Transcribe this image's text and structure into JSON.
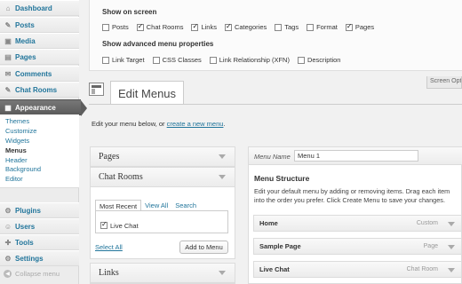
{
  "sidebar": {
    "items": [
      {
        "label": "Dashboard",
        "icon": "dashboard-icon",
        "glyph": "⌂"
      },
      {
        "label": "Posts",
        "icon": "pin-icon",
        "glyph": "✎"
      },
      {
        "label": "Media",
        "icon": "media-icon",
        "glyph": "▣"
      },
      {
        "label": "Pages",
        "icon": "pages-icon",
        "glyph": "▤"
      },
      {
        "label": "Comments",
        "icon": "comments-icon",
        "glyph": "✉"
      },
      {
        "label": "Chat Rooms",
        "icon": "chat-icon",
        "glyph": "✎"
      },
      {
        "label": "Appearance",
        "icon": "appearance-icon",
        "glyph": "▦"
      }
    ],
    "submenu": [
      "Themes",
      "Customize",
      "Widgets",
      "Menus",
      "Header",
      "Background",
      "Editor"
    ],
    "bottom_items": [
      {
        "label": "Plugins",
        "icon": "plugins-icon",
        "glyph": "⚙"
      },
      {
        "label": "Users",
        "icon": "users-icon",
        "glyph": "☺"
      },
      {
        "label": "Tools",
        "icon": "tools-icon",
        "glyph": "✚"
      },
      {
        "label": "Settings",
        "icon": "settings-icon",
        "glyph": "⚙"
      }
    ],
    "collapse_label": "Collapse menu"
  },
  "screen_options": {
    "show_on_screen": "Show on screen",
    "boxes": [
      {
        "label": "Posts",
        "checked": false
      },
      {
        "label": "Chat Rooms",
        "checked": true
      },
      {
        "label": "Links",
        "checked": true
      },
      {
        "label": "Categories",
        "checked": true
      },
      {
        "label": "Tags",
        "checked": false
      },
      {
        "label": "Format",
        "checked": false
      },
      {
        "label": "Pages",
        "checked": true
      }
    ],
    "advanced_heading": "Show advanced menu properties",
    "advanced": [
      {
        "label": "Link Target",
        "checked": false
      },
      {
        "label": "CSS Classes",
        "checked": false
      },
      {
        "label": "Link Relationship (XFN)",
        "checked": false
      },
      {
        "label": "Description",
        "checked": false
      }
    ],
    "tab_label": "Screen Opti"
  },
  "page_title": "Edit Menus",
  "intro": {
    "text": "Edit your menu below, or ",
    "link": "create a new menu",
    "end": "."
  },
  "left": {
    "pages_label": "Pages",
    "chat_rooms_label": "Chat Rooms",
    "tabs": [
      "Most Recent",
      "View All",
      "Search"
    ],
    "recent_item": {
      "label": "Live Chat",
      "checked": true
    },
    "select_all": "Select All",
    "add_button": "Add to Menu",
    "links_label": "Links"
  },
  "right": {
    "menu_name_label": "Menu Name",
    "menu_name_value": "Menu 1",
    "structure_title": "Menu Structure",
    "structure_desc": "Edit your default menu by adding or removing items. Drag each item into the order you prefer. Click Create Menu to save your changes.",
    "items": [
      {
        "label": "Home",
        "type": "Custom"
      },
      {
        "label": "Sample Page",
        "type": "Page"
      },
      {
        "label": "Live Chat",
        "type": "Chat Room"
      }
    ]
  }
}
